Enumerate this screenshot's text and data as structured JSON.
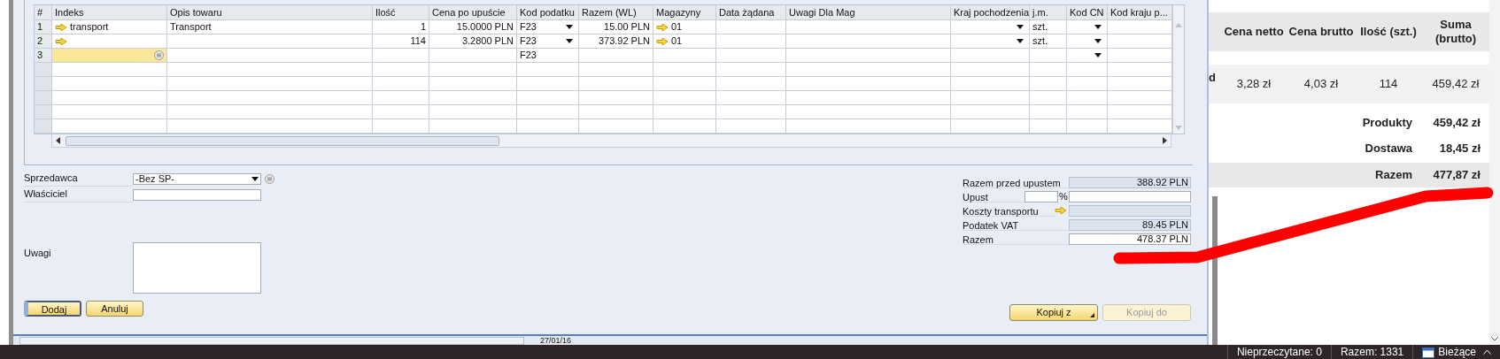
{
  "table": {
    "columns": [
      {
        "label": "#"
      },
      {
        "label": "Indeks"
      },
      {
        "label": "Opis towaru"
      },
      {
        "label": "Ilość"
      },
      {
        "label": "Cena po upuście"
      },
      {
        "label": "Kod podatku"
      },
      {
        "label": "Razem (WL)"
      },
      {
        "label": "Magazyny"
      },
      {
        "label": "Data żądana"
      },
      {
        "label": "Uwagi Dla Mag"
      },
      {
        "label": "Kraj pochodzenia"
      },
      {
        "label": "j.m."
      },
      {
        "label": "Kod CN"
      },
      {
        "label": "Kod kraju p..."
      }
    ],
    "rows": [
      {
        "selected": false,
        "cells": [
          {
            "text": "1"
          },
          {
            "text": "transport",
            "link": true
          },
          {
            "text": "Transport"
          },
          {
            "text": "1"
          },
          {
            "text": "15.0000 PLN"
          },
          {
            "text": "F23",
            "dropdown": true
          },
          {
            "text": "15.00 PLN"
          },
          {
            "text": "01",
            "link": true
          },
          {},
          {},
          {
            "dropdown": true
          },
          {
            "text": "szt."
          },
          {
            "dropdown": true
          },
          {}
        ]
      },
      {
        "selected": false,
        "cells": [
          {
            "text": "2"
          },
          {
            "link": true
          },
          {},
          {
            "text": "114"
          },
          {
            "text": "3.2800 PLN"
          },
          {
            "text": "F23",
            "dropdown": true
          },
          {
            "text": "373.92 PLN"
          },
          {
            "text": "01",
            "link": true
          },
          {},
          {},
          {
            "dropdown": true
          },
          {
            "text": "szt."
          },
          {
            "dropdown": true
          },
          {}
        ]
      },
      {
        "selected": true,
        "cells": [
          {
            "text": "3"
          },
          {},
          {},
          {},
          {},
          {
            "text": "F23"
          },
          {},
          {},
          {},
          {},
          {},
          {},
          {
            "dropdown": true
          },
          {}
        ]
      }
    ]
  },
  "form": {
    "sales_employee": {
      "label": "Sprzedawca",
      "value": "-Bez SP-"
    },
    "owner": {
      "label": "Właściciel"
    },
    "remarks": {
      "label": "Uwagi"
    }
  },
  "buttons": [
    {
      "label": "Dodaj",
      "default": true
    },
    {
      "label": "Anuluj",
      "default": false
    }
  ],
  "totals": [
    {
      "kind": "readonly",
      "label": "Razem przed upustem",
      "value": "388.92 PLN"
    },
    {
      "kind": "discount",
      "label": "Upust",
      "unit": "%"
    },
    {
      "kind": "link",
      "label": "Koszty transportu"
    },
    {
      "kind": "readonly",
      "label": "Podatek VAT",
      "value": "89.45 PLN"
    },
    {
      "kind": "editable",
      "label": "Razem",
      "value": "478.37 PLN"
    }
  ],
  "copy_buttons": [
    {
      "label": "Kopiuj z",
      "menu": true,
      "disabled": false
    },
    {
      "label": "Kopiuj do",
      "menu": false,
      "disabled": true
    }
  ],
  "status_strip": {
    "date": "27/01/16"
  },
  "order_summary": {
    "columns": [
      "Cena netto",
      "Cena brutto",
      "Ilość (szt.)",
      "Suma (brutto)"
    ],
    "item": {
      "column_1": "d",
      "cells": [
        "3,28 zł",
        "4,03 zł",
        "114",
        "459,42 zł"
      ]
    },
    "totals": [
      {
        "kind": "line",
        "label": "Produkty",
        "value": "459,42 zł"
      },
      {
        "kind": "line",
        "label": "Dostawa",
        "value": "18,45 zł"
      },
      {
        "kind": "total",
        "label": "Razem",
        "value": "477,87 zł"
      }
    ]
  },
  "taskbar": [
    {
      "kind": "label",
      "text": "Nieprzeczytane: 0"
    },
    {
      "kind": "label",
      "text": "Razem: 1331"
    },
    {
      "kind": "calendar",
      "text": "Bieżące"
    }
  ]
}
